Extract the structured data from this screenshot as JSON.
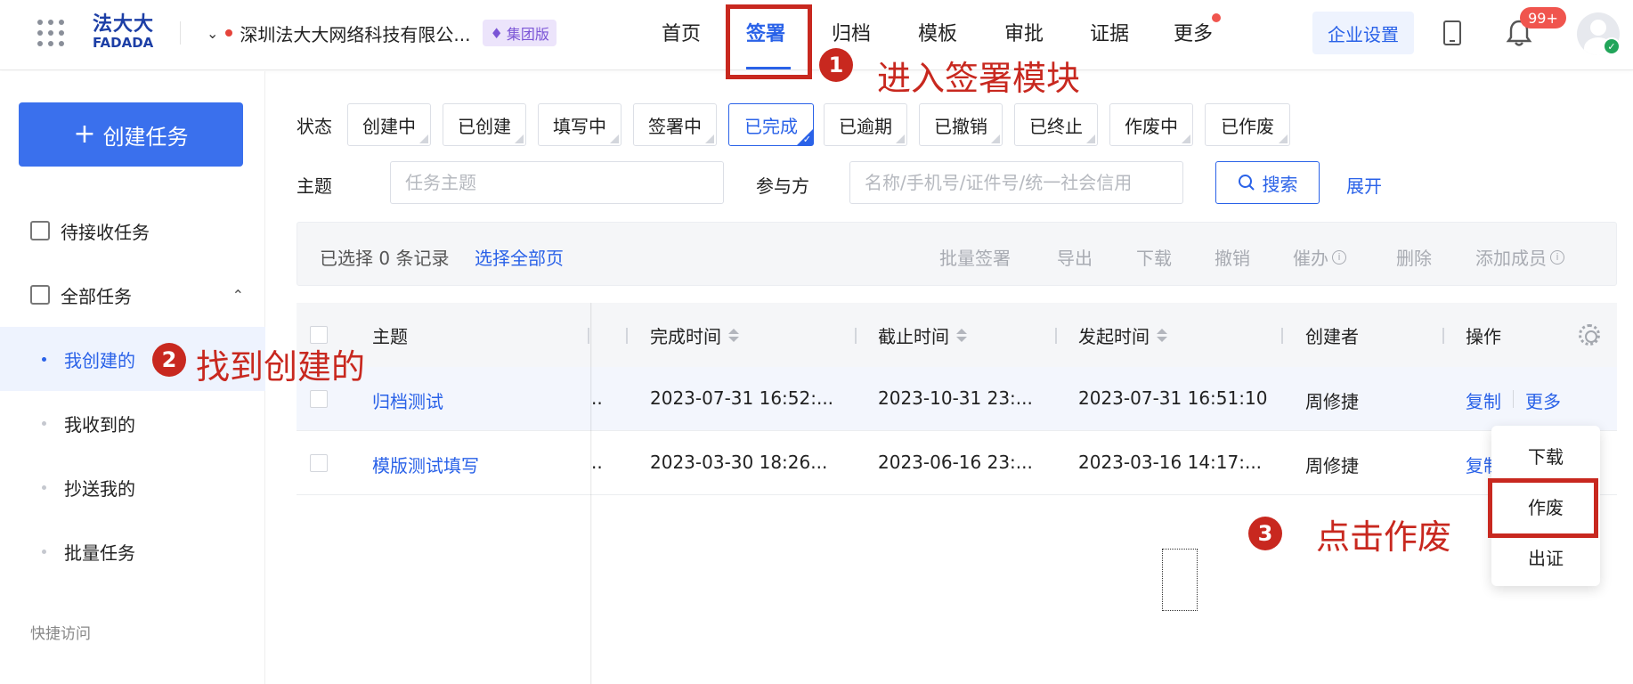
{
  "header": {
    "logo_big": "法大大",
    "logo_small": "FADADA",
    "company": "深圳法大大网络科技有限公...",
    "edition_badge": "集团版",
    "nav": [
      {
        "label": "首页"
      },
      {
        "label": "签署"
      },
      {
        "label": "归档"
      },
      {
        "label": "模板"
      },
      {
        "label": "审批"
      },
      {
        "label": "证据"
      },
      {
        "label": "更多"
      }
    ],
    "enterprise_settings": "企业设置",
    "notification_count": "99+"
  },
  "sidebar": {
    "create_task": "创建任务",
    "pending_receive": "待接收任务",
    "all_tasks": "全部任务",
    "sub_items": [
      {
        "label": "我创建的"
      },
      {
        "label": "我收到的"
      },
      {
        "label": "抄送我的"
      },
      {
        "label": "批量任务"
      }
    ],
    "quick_access": "快捷访问"
  },
  "filters": {
    "status_label": "状态",
    "statuses": [
      "创建中",
      "已创建",
      "填写中",
      "签署中",
      "已完成",
      "已逾期",
      "已撤销",
      "已终止",
      "作废中",
      "已作废"
    ],
    "active_status": "已完成",
    "subject_label": "主题",
    "subject_placeholder": "任务主题",
    "participant_label": "参与方",
    "participant_placeholder": "名称/手机号/证件号/统一社会信用",
    "search": "搜索",
    "expand": "展开"
  },
  "toolbar": {
    "selected": "已选择 0 条记录",
    "select_all": "选择全部页",
    "actions": [
      "批量签署",
      "导出",
      "下载",
      "撤销",
      "催办",
      "删除",
      "添加成员"
    ]
  },
  "table": {
    "headers": {
      "subject": "主题",
      "completed": "完成时间",
      "deadline": "截止时间",
      "initiated": "发起时间",
      "creator": "创建者",
      "operation": "操作"
    },
    "rows": [
      {
        "subject": "归档测试",
        "partial": "..",
        "completed": "2023-07-31 16:52:...",
        "deadline": "2023-10-31 23:...",
        "initiated": "2023-07-31 16:51:10",
        "creator": "周修捷",
        "op1": "复制",
        "op2": "更多"
      },
      {
        "subject": "模版测试填写",
        "partial": "..",
        "completed": "2023-03-30 18:26...",
        "deadline": "2023-06-16 23:...",
        "initiated": "2023-03-16 14:17:...",
        "creator": "周修捷",
        "op1": "复制"
      }
    ]
  },
  "dropdown": {
    "items": [
      "下载",
      "作废",
      "出证"
    ]
  },
  "annotations": {
    "step1_num": "1",
    "step1_text": "进入签署模块",
    "step2_num": "2",
    "step2_text": "找到创建的",
    "step3_num": "3",
    "step3_text": "点击作废",
    "color": "#c8281f"
  },
  "colors": {
    "primary": "#2a62e8",
    "create_button": "#3a70ed",
    "badge_red": "#f0554e"
  }
}
